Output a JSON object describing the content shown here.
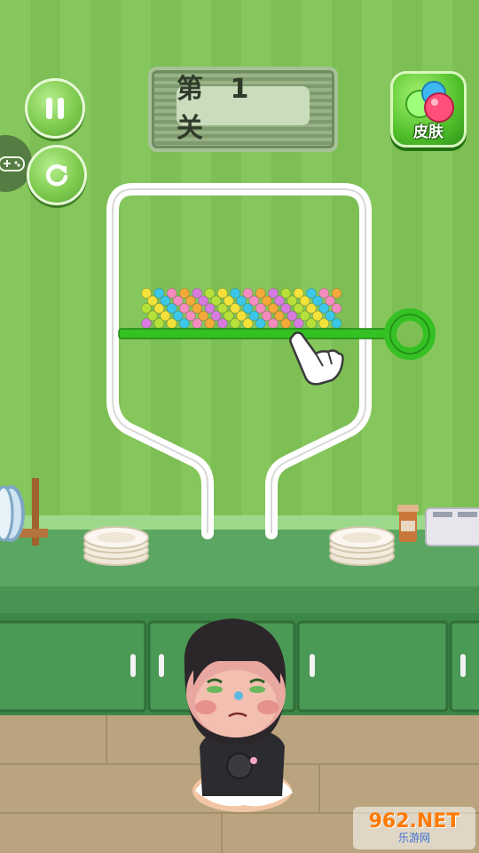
{
  "level": {
    "label": "第 1 关"
  },
  "skin_button": {
    "label": "皮肤"
  },
  "watermark": {
    "brand": "962.NET",
    "site": "乐游网"
  },
  "icons": {
    "pause": "pause-icon",
    "restart": "restart-icon",
    "gamepad": "gamepad-icon",
    "skin": "skin-balls-icon",
    "hand": "pointing-hand-icon"
  },
  "colors": {
    "wall": "#7dbf55",
    "wall_stripe": "#88c85f",
    "counter": "#4f9a57",
    "cabinet": "#3f8a4a",
    "floor": "#b9a47f",
    "pin": "#35c024",
    "pin_ring": "#29a81a",
    "tube": "#ffffff"
  },
  "candy_colors": [
    "#d87be0",
    "#b6e03a",
    "#f4e23a",
    "#3cc7e8",
    "#f58bbf",
    "#f4a93a"
  ]
}
